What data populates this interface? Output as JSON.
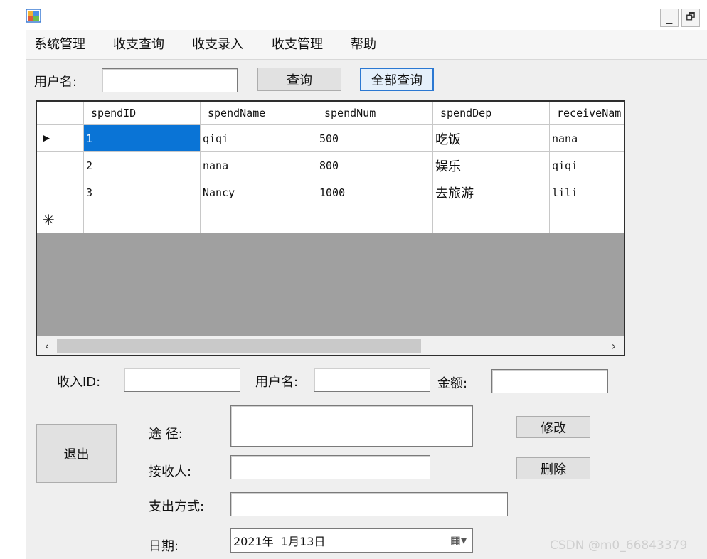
{
  "window": {
    "icon": "app-window-icon",
    "minimize_glyph": "_",
    "restore_glyph": "🗗"
  },
  "menu": {
    "items": [
      "系统管理",
      "收支查询",
      "收支录入",
      "收支管理",
      "帮助"
    ]
  },
  "search": {
    "username_label": "用户名:",
    "username_value": "",
    "query_button": "查询",
    "query_all_button": "全部查询"
  },
  "grid": {
    "columns": [
      "spendID",
      "spendName",
      "spendNum",
      "spendDep",
      "receiveNam"
    ],
    "rows": [
      [
        "1",
        "qiqi",
        "500",
        "吃饭",
        "nana"
      ],
      [
        "2",
        "nana",
        "800",
        "娱乐",
        "qiqi"
      ],
      [
        "3",
        "Nancy",
        "1000",
        "去旅游",
        "lili"
      ]
    ],
    "current_row_marker": "▶",
    "new_row_marker": "✳",
    "scroll_left": "‹",
    "scroll_right": "›"
  },
  "form": {
    "income_id_label": "收入ID:",
    "income_id_value": "",
    "username_label": "用户名:",
    "username_value": "",
    "amount_label": "金额:",
    "amount_value": "",
    "route_label": "途 径:",
    "route_value": "",
    "receiver_label": "接收人:",
    "receiver_value": "",
    "pay_method_label": "支出方式:",
    "pay_method_value": "",
    "date_label": "日期:",
    "date_value": "2021年  1月13日",
    "date_dropdown_glyph": "▦▾"
  },
  "buttons": {
    "exit": "退出",
    "modify": "修改",
    "delete": "删除"
  },
  "watermark": "CSDN @m0_66843379"
}
